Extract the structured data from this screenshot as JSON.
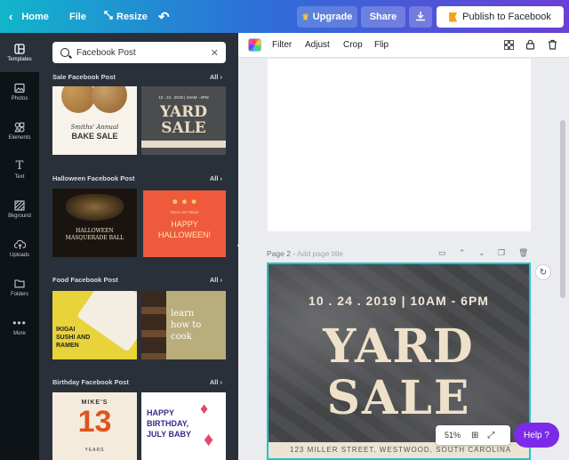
{
  "topbar": {
    "home": "Home",
    "file": "File",
    "resize": "Resize",
    "upgrade": "Upgrade",
    "share": "Share",
    "publish": "Publish to Facebook"
  },
  "rail": [
    {
      "label": "Templates",
      "icon": "templates-icon"
    },
    {
      "label": "Photos",
      "icon": "photos-icon"
    },
    {
      "label": "Elements",
      "icon": "elements-icon"
    },
    {
      "label": "Text",
      "icon": "text-icon"
    },
    {
      "label": "Bkground",
      "icon": "background-icon"
    },
    {
      "label": "Uploads",
      "icon": "uploads-icon"
    },
    {
      "label": "Folders",
      "icon": "folders-icon"
    },
    {
      "label": "More",
      "icon": "more-icon"
    }
  ],
  "search": {
    "value": "Facebook Post"
  },
  "sections": [
    {
      "title": "Sale Facebook Post",
      "all": "All"
    },
    {
      "title": "Halloween Facebook Post",
      "all": "All"
    },
    {
      "title": "Food Facebook Post",
      "all": "All"
    },
    {
      "title": "Birthday Facebook Post",
      "all": "All"
    }
  ],
  "thumbs": {
    "sale1": {
      "line1": "Smiths' Annual",
      "line2": "BAKE SALE"
    },
    "sale2": {
      "date": "10 . 24 . 2019 | 10AM - 4PM",
      "line1": "YARD",
      "line2": "SALE"
    },
    "hall1": {
      "line1": "HALLOWEEN",
      "line2": "MASQUERADE BALL"
    },
    "hall2": {
      "line1": "HAPPY",
      "line2": "HALLOWEEN!",
      "small": "TRICK OR TREAT"
    },
    "food1": {
      "line1": "IKIGAI",
      "line2": "SUSHI AND",
      "line3": "RAMEN"
    },
    "food2": {
      "line1": "learn",
      "line2": "how to",
      "line3": "cook"
    },
    "bday1": {
      "name": "MIKE'S",
      "num": "13",
      "years": "YEARS"
    },
    "bday2": {
      "line1": "HAPPY",
      "line2": "BIRTHDAY,",
      "line3": "JULY BABY"
    }
  },
  "toolbar": {
    "filter": "Filter",
    "adjust": "Adjust",
    "crop": "Crop",
    "flip": "Flip"
  },
  "page2": {
    "label": "Page 2 -",
    "title_placeholder": "Add page title",
    "date": "10 . 24 . 2019 | 10AM - 6PM",
    "line1": "YARD",
    "line2": "SALE",
    "address": "123 MILLER STREET, WESTWOOD, SOUTH CAROLINA"
  },
  "zoom": "51%",
  "help": "Help ?",
  "colors": {
    "accent": "#7d2ae8",
    "selection": "#20c4cf",
    "panel": "#293039"
  }
}
